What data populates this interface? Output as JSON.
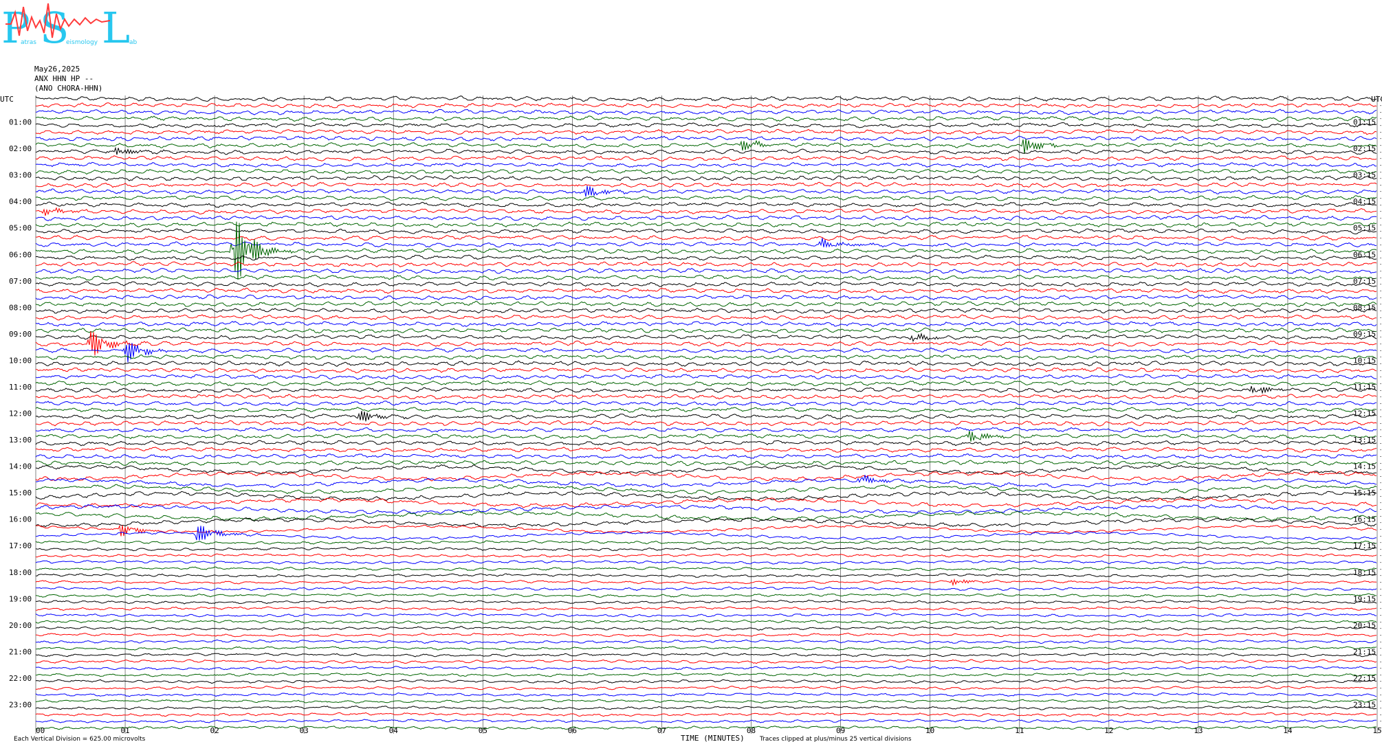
{
  "logo": {
    "letters": [
      "P",
      "S",
      "L"
    ],
    "small_texts": [
      "atras",
      "eismology",
      "ab"
    ]
  },
  "header": {
    "date": "May26,2025",
    "station": "ANX HHN HP --",
    "channel": "(ANO CHORA-HHN)"
  },
  "chart_data": {
    "type": "line",
    "title": "",
    "xlabel": "TIME (MINUTES)",
    "ylabel": "",
    "x_ticks": [
      "00",
      "01",
      "02",
      "03",
      "04",
      "05",
      "06",
      "07",
      "08",
      "09",
      "10",
      "11",
      "12",
      "13",
      "14",
      "15"
    ],
    "xlim": [
      0,
      15
    ],
    "grid": "vertical",
    "left_axis_label": "UTC",
    "right_axis_label": "UTC",
    "left_times": [
      "01:00",
      "02:00",
      "03:00",
      "04:00",
      "05:00",
      "06:00",
      "07:00",
      "08:00",
      "09:00",
      "10:00",
      "11:00",
      "12:00",
      "13:00",
      "14:00",
      "15:00",
      "16:00",
      "17:00",
      "18:00",
      "19:00",
      "20:00",
      "21:00",
      "22:00",
      "23:00"
    ],
    "right_times": [
      "01:15",
      "02:15",
      "03:15",
      "04:15",
      "05:15",
      "06:15",
      "07:15",
      "08:15",
      "09:15",
      "10:15",
      "11:15",
      "12:15",
      "13:15",
      "14:15",
      "15:15",
      "16:15",
      "17:15",
      "18:15",
      "19:15",
      "20:15",
      "21:15",
      "22:15",
      "23:15"
    ],
    "trace_count": 96,
    "trace_colors": [
      "#000000",
      "#ff0000",
      "#0000ff",
      "#006400"
    ],
    "trace_offsets": [
      "-9586",
      "-9588",
      "-9532",
      "-9733",
      "-9446",
      "-9483",
      "-9555",
      "-9312",
      "-9465",
      "-9478",
      "-9444",
      "-9365",
      "-9369",
      "-9591",
      "-9424",
      "-9444",
      "-9372",
      "-9411",
      "-9379",
      "-9411",
      "-9264",
      "-9468",
      "-9376",
      "-9283",
      "-9157",
      "-9113",
      "-9317",
      "-9232",
      "-9073",
      "-9054",
      "-9012",
      "-8990",
      "-8882",
      "-9173",
      "-8927",
      "-8846",
      "-8774",
      "-9116",
      "-8839",
      "-8895",
      "-8925",
      "-8983",
      "-8879",
      "-8804",
      "-9165",
      "-9214",
      "-9292",
      "-9401",
      "-9224",
      "-9230",
      "-9366",
      "-9376",
      "-9028",
      "-8983",
      "-9081",
      "-9168",
      "-8504",
      "-8072",
      "-8147",
      "-9234",
      "-7437",
      "-9698",
      "-9779",
      "-9266",
      "-9243",
      "-9353",
      "-9680",
      "-9727",
      "-9777",
      "-9721",
      "-9765",
      "-9680",
      "-9735",
      "-9712",
      "-9590",
      "-9669",
      "-9712",
      "-9665",
      "-9600",
      "-9665",
      "-9571",
      "-9559",
      "-9565",
      "-9577",
      "-9591",
      "-9664",
      "-9618",
      "-9615",
      "-9644",
      "-9532",
      "-9512",
      "-9486",
      "-9445",
      "-9453",
      "-9521",
      "-9478"
    ],
    "events": [
      {
        "row": 7,
        "minute": 11.05,
        "amplitude": 4
      },
      {
        "row": 7,
        "minute": 7.9,
        "amplitude": 2.5
      },
      {
        "row": 8,
        "minute": 0.9,
        "amplitude": 2
      },
      {
        "row": 14,
        "minute": 6.15,
        "amplitude": 3
      },
      {
        "row": 17,
        "minute": 0.1,
        "amplitude": 2
      },
      {
        "row": 23,
        "minute": 2.2,
        "amplitude": 22
      },
      {
        "row": 22,
        "minute": 8.75,
        "amplitude": 3
      },
      {
        "row": 37,
        "minute": 0.6,
        "amplitude": 8
      },
      {
        "row": 38,
        "minute": 1.0,
        "amplitude": 6
      },
      {
        "row": 36,
        "minute": 9.8,
        "amplitude": 2
      },
      {
        "row": 44,
        "minute": 13.6,
        "amplitude": 3
      },
      {
        "row": 48,
        "minute": 3.6,
        "amplitude": 4
      },
      {
        "row": 51,
        "minute": 10.45,
        "amplitude": 3
      },
      {
        "row": 58,
        "minute": 9.2,
        "amplitude": 3
      },
      {
        "row": 65,
        "minute": 0.95,
        "amplitude": 3
      },
      {
        "row": 66,
        "minute": 1.8,
        "amplitude": 5
      },
      {
        "row": 73,
        "minute": 10.25,
        "amplitude": 1.5
      }
    ],
    "footer_left": "Each Vertical Division =  625.00 microvolts",
    "footer_right": "Traces clipped at plus/minus 25 vertical divisions"
  }
}
